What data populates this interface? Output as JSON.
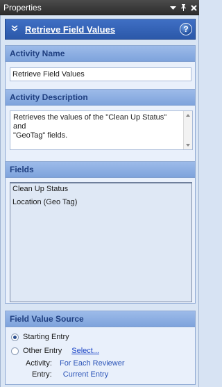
{
  "window": {
    "title": "Properties",
    "icons": [
      "chevron-down-icon",
      "pin-icon",
      "close-icon"
    ]
  },
  "header": {
    "title": "Retrieve Field Values",
    "help_label": "?"
  },
  "activity_name": {
    "heading": "Activity Name",
    "value": "Retrieve Field Values"
  },
  "activity_description": {
    "heading": "Activity Description",
    "line1": "Retrieves the values of the \"Clean Up Status\" and",
    "line2": "\"GeoTag\" fields."
  },
  "fields": {
    "heading": "Fields",
    "items": [
      "Clean Up Status",
      "Location (Geo Tag)"
    ]
  },
  "field_value_source": {
    "heading": "Field Value Source",
    "option_starting": "Starting Entry",
    "option_other": "Other Entry",
    "select_link": "Select...",
    "activity_label": "Activity:",
    "activity_value": "For Each Reviewer",
    "entry_label": "Entry:",
    "entry_value": "Current Entry",
    "selected": "Starting Entry"
  },
  "colors": {
    "header_blue": "#2b58a9",
    "panel_head": "#7ea3dc",
    "link": "#1a44c6"
  }
}
